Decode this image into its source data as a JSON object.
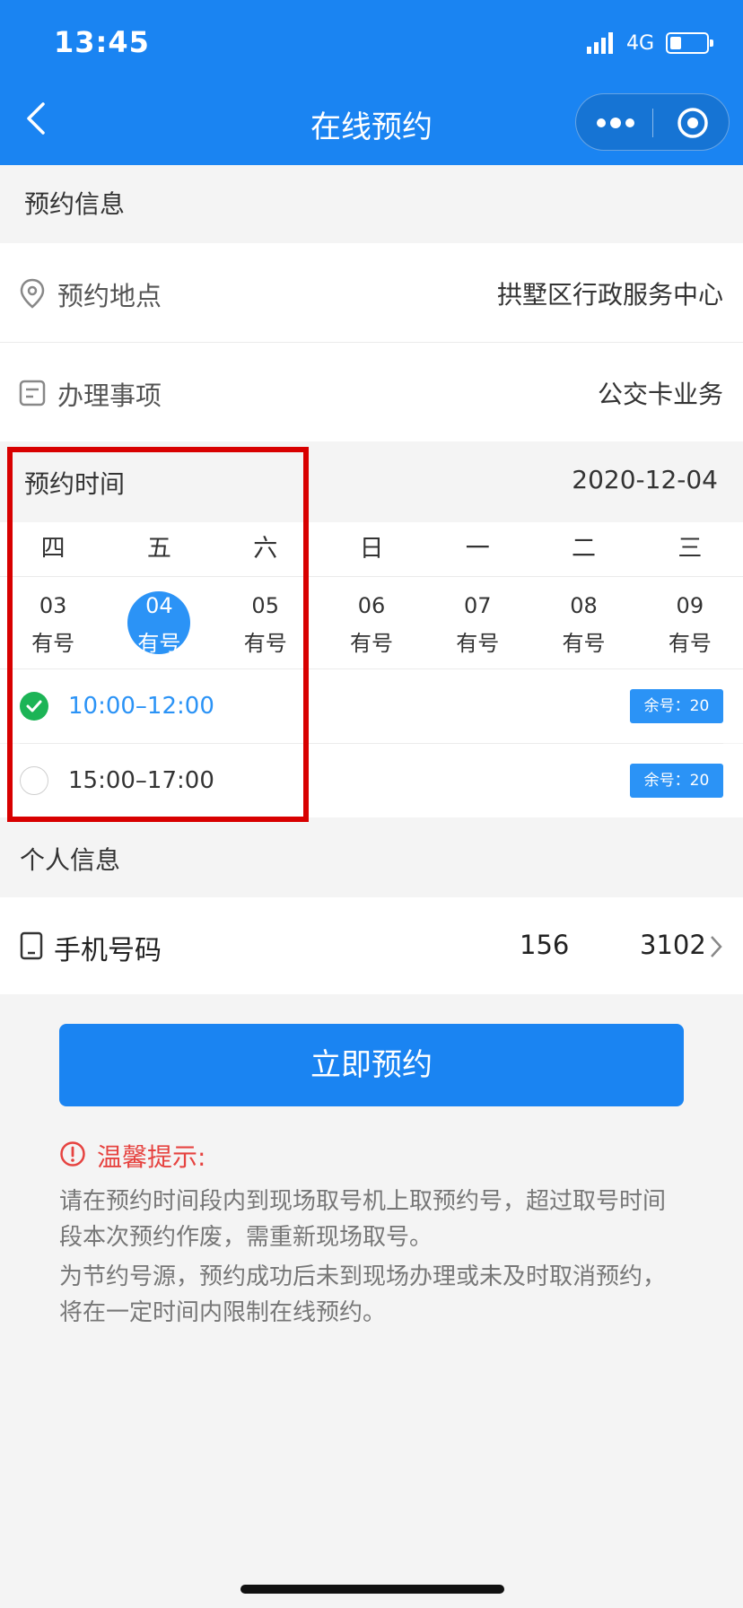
{
  "status_bar": {
    "time": "13:45",
    "network": "4G"
  },
  "header": {
    "title": "在线预约"
  },
  "booking_info": {
    "section_title": "预约信息",
    "location_label": "预约地点",
    "location_value": "拱墅区行政服务中心",
    "matter_label": "办理事项",
    "matter_value": "公交卡业务"
  },
  "booking_time": {
    "section_title": "预约时间",
    "selected_date": "2020-12-04",
    "weekdays": [
      "四",
      "五",
      "六",
      "日",
      "一",
      "二",
      "三"
    ],
    "dates": [
      {
        "day": "03",
        "status": "有号"
      },
      {
        "day": "04",
        "status": "有号"
      },
      {
        "day": "05",
        "status": "有号"
      },
      {
        "day": "06",
        "status": "有号"
      },
      {
        "day": "07",
        "status": "有号"
      },
      {
        "day": "08",
        "status": "有号"
      },
      {
        "day": "09",
        "status": "有号"
      }
    ],
    "selected_index": 1,
    "slots": [
      {
        "time": "10:00–12:00",
        "remaining": "余号：20",
        "selected": true
      },
      {
        "time": "15:00–17:00",
        "remaining": "余号：20",
        "selected": false
      }
    ]
  },
  "personal_info": {
    "section_title": "个人信息",
    "phone_label": "手机号码",
    "phone_value_start": "156",
    "phone_value_end": "3102"
  },
  "submit": {
    "label": "立即预约"
  },
  "tips": {
    "title": "温馨提示:",
    "line1": "请在预约时间段内到现场取号机上取预约号，超过取号时间段本次预约作废，需重新现场取号。",
    "line2": "为节约号源，预约成功后未到现场办理或未及时取消预约，将在一定时间内限制在线预约。"
  },
  "colors": {
    "brand": "#1a84f2",
    "accent": "#2b93f6",
    "success": "#1cb456",
    "warning": "#e64340",
    "highlight": "#d80000"
  },
  "icons": [
    "back-arrow-icon",
    "more-icon",
    "target-icon",
    "location-pin-icon",
    "document-icon",
    "check-icon",
    "phone-icon",
    "chevron-right-icon",
    "alert-circle-icon"
  ]
}
